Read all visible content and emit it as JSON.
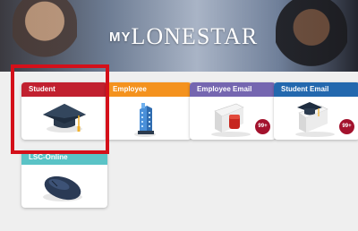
{
  "banner": {
    "logo_my": "MY",
    "logo_name": "LONESTAR"
  },
  "tiles": [
    {
      "label": "Student",
      "color": "#c1202f",
      "icon": "graduation-cap-icon"
    },
    {
      "label": "Employee",
      "color": "#f4921e",
      "icon": "office-building-icon"
    },
    {
      "label": "Employee Email",
      "color": "#7566b0",
      "icon": "mailbox-icon",
      "badge": "99+"
    },
    {
      "label": "Student Email",
      "color": "#2368ae",
      "icon": "mailbox-cap-icon",
      "badge": "99+"
    },
    {
      "label": "LSC-Online",
      "color": "#5ac3c6",
      "icon": "computer-mouse-icon"
    }
  ],
  "highlight_color": "#d4101a"
}
